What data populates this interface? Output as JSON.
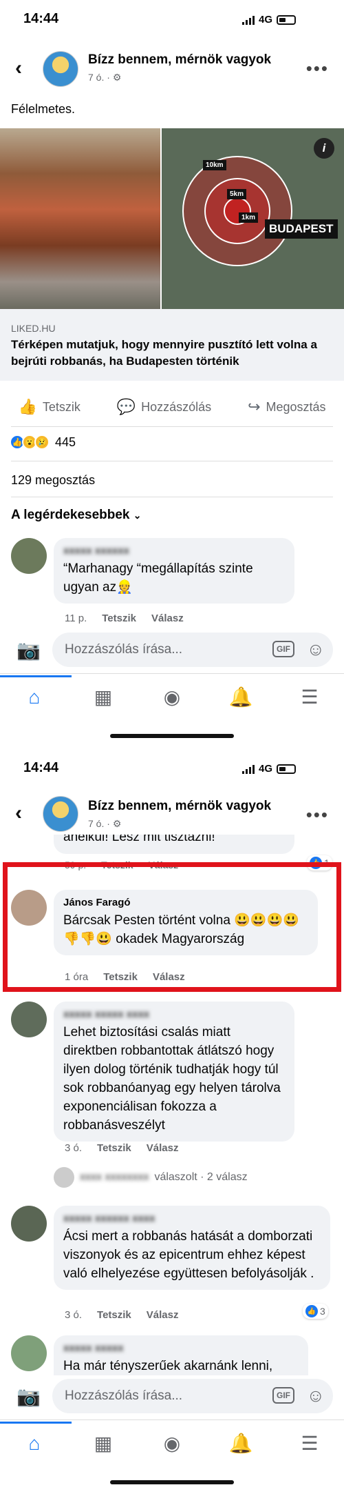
{
  "status": {
    "time": "14:44",
    "network": "4G"
  },
  "page": {
    "name": "Bízz bennem, mérnök vagyok",
    "age": "7 ó.",
    "privacy_icon": "gear-icon"
  },
  "post": {
    "text": "Félelmetes.",
    "image_labels": {
      "r10": "10km",
      "r5": "5km",
      "r1": "1km",
      "city": "BUDAPEST",
      "info": "i"
    },
    "link_domain": "LIKED.HU",
    "link_title": "Térképen mutatjuk, hogy mennyire pusztító lett volna a bejrúti robbanás, ha Budapesten történik"
  },
  "actions": {
    "like": "Tetszik",
    "comment": "Hozzászólás",
    "share": "Megosztás"
  },
  "reactions": {
    "count": "445",
    "types": [
      "like",
      "wow",
      "sad"
    ]
  },
  "shares": "129 megosztás",
  "sort_label": "A legérdekesebbek",
  "comments_top": [
    {
      "name": "xxxxx xxxxxx",
      "text": "“Marhanagy “megállapítás szinte ugyan az👷",
      "time": "11 p.",
      "like": "Tetszik",
      "reply": "Válasz"
    }
  ],
  "composer": {
    "placeholder": "Hozzászólás írása...",
    "gif": "GIF"
  },
  "truncated": {
    "text": "anélkül! Lesz mit tisztázni!",
    "time": "59 p.",
    "like": "Tetszik",
    "reply": "Válasz",
    "likes": "1"
  },
  "highlighted_comment": {
    "name": "János Faragó",
    "text": "Bárcsak Pesten történt volna 😃😃😃😃👎👎😃 okadek Magyarország",
    "time": "1 óra",
    "like": "Tetszik",
    "reply": "Válasz"
  },
  "comments_bottom": [
    {
      "name": "xxxxx xxxxx xxxx",
      "text": "Lehet biztosítási csalás miatt direktben robbantottak átlátszó hogy ilyen dolog történik tudhatják hogy túl sok robbanóanyag egy helyen tárolva exponenciálisan fokozza a robbanásveszélyt",
      "time": "3 ó.",
      "like": "Tetszik",
      "reply": "Válasz"
    },
    {
      "name": "xxxxx xxxxxx xxxx",
      "text": "Ácsi mert a robbanás hatását a domborzati viszonyok és az epicentrum ehhez képest való elhelyezése együttesen befolyásolják .",
      "time": "3 ó.",
      "like": "Tetszik",
      "reply": "Válasz",
      "likes": "3"
    },
    {
      "name": "xxxxx xxxxx",
      "text": "Ha már tényszerűek akarnánk lenni,"
    }
  ],
  "replies_line": {
    "name": "xxxx xxxxxxxx",
    "text": "válaszolt · 2 válasz"
  }
}
